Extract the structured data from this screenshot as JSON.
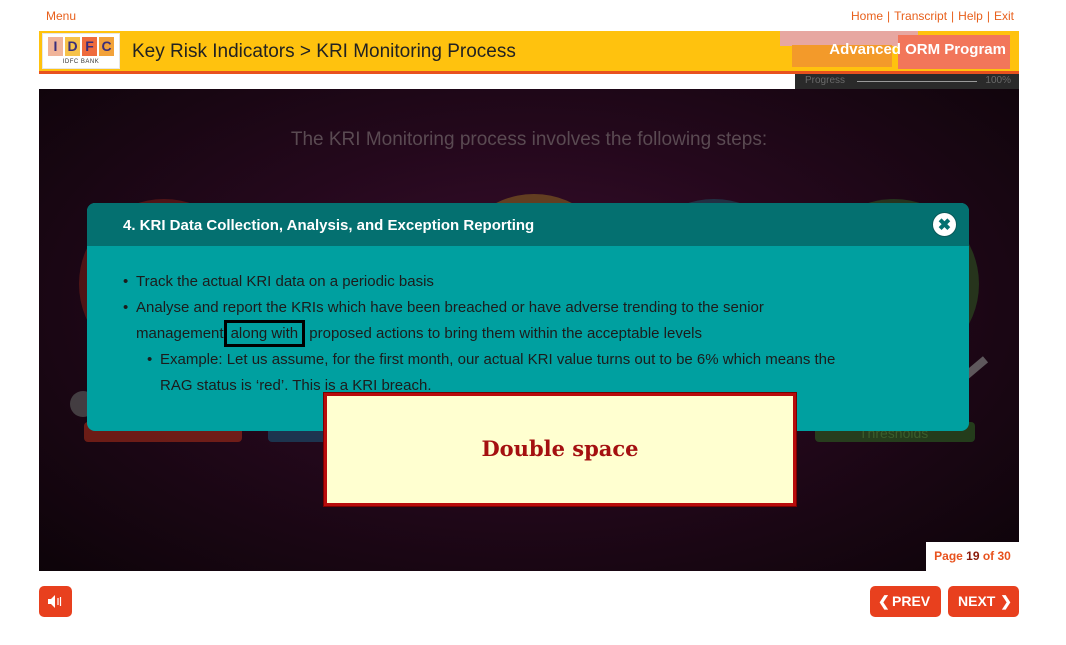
{
  "nav": {
    "menu": "Menu",
    "links": [
      "Home",
      "Transcript",
      "Help",
      "Exit"
    ],
    "separator": "|"
  },
  "header": {
    "logo_letters": [
      "I",
      "D",
      "F",
      "C"
    ],
    "logo_sub": "IDFC BANK",
    "title": "Key Risk Indicators > KRI Monitoring Process",
    "program": "Advanced ORM Program"
  },
  "progress": {
    "label": "Progress",
    "value_text": "100%",
    "value": 1.0
  },
  "stage": {
    "intro": "The KRI Monitoring process involves the following steps:",
    "thresholds_label": "Thresholds"
  },
  "modal": {
    "title": "4. KRI Data Collection, Analysis, and Exception Reporting",
    "close_glyph": "✖",
    "bullet1": "Track the actual KRI data on a periodic basis",
    "bullet2_line1": "Analyse and report the KRIs which have been breached or have adverse trending to the senior",
    "bullet2_line2_pre": "management",
    "bullet2_line2_highlight": "along  with",
    "bullet2_line2_post": " proposed actions to bring them within the acceptable levels",
    "sub_line1": "Example: Let us assume, for the first month, our actual KRI value turns out to be 6% which means the",
    "sub_line2": "RAG status is ‘red’. This is a KRI breach."
  },
  "callout": {
    "text": "Double space"
  },
  "pager": {
    "prefix": "Page ",
    "current": "19",
    "suffix": " of 30"
  },
  "controls": {
    "prev": "PREV",
    "next": "NEXT",
    "audio_icon": "speaker-icon"
  },
  "colors": {
    "accent": "#e8401e",
    "header_yellow": "#ffc20e",
    "modal_teal": "#00a0a0",
    "modal_header": "#047070",
    "callout_border": "#b80c0c"
  }
}
